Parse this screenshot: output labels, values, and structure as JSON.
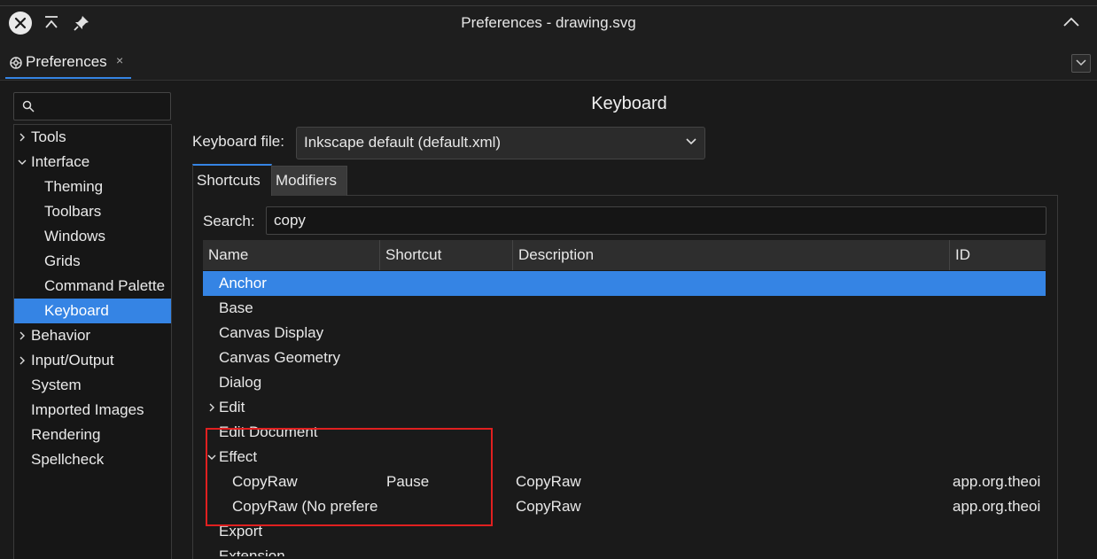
{
  "window": {
    "title": "Preferences - drawing.svg"
  },
  "tabs": {
    "active_label": "Preferences",
    "close_glyph": "×"
  },
  "sidebar": {
    "search_placeholder": "",
    "items": [
      {
        "label": "Tools",
        "expander": "collapsed",
        "level": 0
      },
      {
        "label": "Interface",
        "expander": "expanded",
        "level": 0
      },
      {
        "label": "Theming",
        "expander": "none",
        "level": 1
      },
      {
        "label": "Toolbars",
        "expander": "none",
        "level": 1
      },
      {
        "label": "Windows",
        "expander": "none",
        "level": 1
      },
      {
        "label": "Grids",
        "expander": "none",
        "level": 1
      },
      {
        "label": "Command Palette",
        "expander": "none",
        "level": 1
      },
      {
        "label": "Keyboard",
        "expander": "none",
        "level": 1,
        "selected": true
      },
      {
        "label": "Behavior",
        "expander": "collapsed",
        "level": 0
      },
      {
        "label": "Input/Output",
        "expander": "collapsed",
        "level": 0
      },
      {
        "label": "System",
        "expander": "none",
        "level": 0
      },
      {
        "label": "Imported Images",
        "expander": "none",
        "level": 0
      },
      {
        "label": "Rendering",
        "expander": "none",
        "level": 0
      },
      {
        "label": "Spellcheck",
        "expander": "none",
        "level": 0
      }
    ]
  },
  "main": {
    "heading": "Keyboard",
    "keyboard_file_label": "Keyboard file:",
    "keyboard_file_value": "Inkscape default (default.xml)",
    "tabs": [
      {
        "label": "Shortcuts",
        "active": true
      },
      {
        "label": "Modifiers",
        "active": false
      }
    ],
    "search_label": "Search:",
    "search_value": "copy",
    "columns": [
      "Name",
      "Shortcut",
      "Description",
      "ID"
    ],
    "rows": [
      {
        "name": "Anchor",
        "shortcut": "",
        "description": "",
        "id": "",
        "level": 0,
        "expander": "none",
        "selected": true
      },
      {
        "name": "Base",
        "shortcut": "",
        "description": "",
        "id": "",
        "level": 0,
        "expander": "none"
      },
      {
        "name": "Canvas Display",
        "shortcut": "",
        "description": "",
        "id": "",
        "level": 0,
        "expander": "none"
      },
      {
        "name": "Canvas Geometry",
        "shortcut": "",
        "description": "",
        "id": "",
        "level": 0,
        "expander": "none"
      },
      {
        "name": "Dialog",
        "shortcut": "",
        "description": "",
        "id": "",
        "level": 0,
        "expander": "none"
      },
      {
        "name": "Edit",
        "shortcut": "",
        "description": "",
        "id": "",
        "level": 0,
        "expander": "collapsed"
      },
      {
        "name": "Edit Document",
        "shortcut": "",
        "description": "",
        "id": "",
        "level": 0,
        "expander": "none"
      },
      {
        "name": "Effect",
        "shortcut": "",
        "description": "",
        "id": "",
        "level": 0,
        "expander": "expanded"
      },
      {
        "name": "CopyRaw",
        "shortcut": "Pause",
        "description": "CopyRaw",
        "id": "app.org.theoi",
        "level": 1,
        "expander": "none"
      },
      {
        "name": "CopyRaw (No prefere",
        "shortcut": "",
        "description": "CopyRaw",
        "id": "app.org.theoi",
        "level": 1,
        "expander": "none"
      },
      {
        "name": "Export",
        "shortcut": "",
        "description": "",
        "id": "",
        "level": 0,
        "expander": "none"
      },
      {
        "name": "Extension",
        "shortcut": "",
        "description": "",
        "id": "",
        "level": 0,
        "expander": "none"
      }
    ]
  },
  "colors": {
    "accent": "#3584e4",
    "highlight_box": "#e02020",
    "background": "#1a1a1a"
  }
}
